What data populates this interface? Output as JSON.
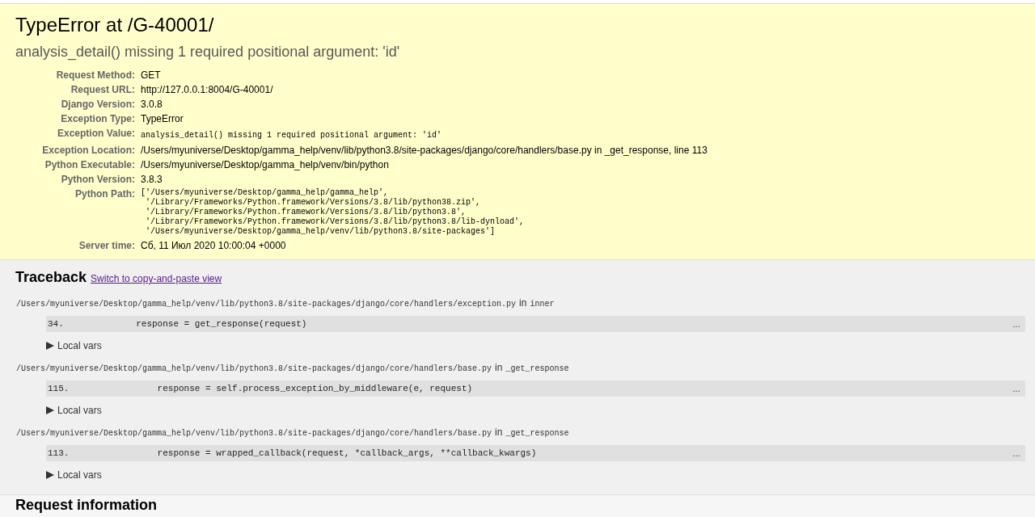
{
  "summary": {
    "title": "TypeError at /G-40001/",
    "subtitle": "analysis_detail() missing 1 required positional argument: 'id'",
    "meta": [
      {
        "label": "Request Method:",
        "kind": "text",
        "value": "GET"
      },
      {
        "label": "Request URL:",
        "kind": "text",
        "value": "http://127.0.0.1:8004/G-40001/"
      },
      {
        "label": "Django Version:",
        "kind": "text",
        "value": "3.0.8"
      },
      {
        "label": "Exception Type:",
        "kind": "text",
        "value": "TypeError"
      },
      {
        "label": "Exception Value:",
        "kind": "code",
        "value": "analysis_detail() missing 1 required positional argument: 'id'"
      },
      {
        "label": "Exception Location:",
        "kind": "text",
        "value": "/Users/myuniverse/Desktop/gamma_help/venv/lib/python3.8/site-packages/django/core/handlers/base.py in _get_response, line 113"
      },
      {
        "label": "Python Executable:",
        "kind": "text",
        "value": "/Users/myuniverse/Desktop/gamma_help/venv/bin/python"
      },
      {
        "label": "Python Version:",
        "kind": "text",
        "value": "3.8.3"
      },
      {
        "label": "Python Path:",
        "kind": "lines",
        "lines": [
          "['/Users/myuniverse/Desktop/gamma_help/gamma_help',",
          " '/Library/Frameworks/Python.framework/Versions/3.8/lib/python38.zip',",
          " '/Library/Frameworks/Python.framework/Versions/3.8/lib/python3.8',",
          " '/Library/Frameworks/Python.framework/Versions/3.8/lib/python3.8/lib-dynload',",
          " '/Users/myuniverse/Desktop/gamma_help/venv/lib/python3.8/site-packages']"
        ]
      },
      {
        "label": "Server time:",
        "kind": "text",
        "value": "Сб, 11 Июл 2020 10:00:04 +0000"
      }
    ]
  },
  "traceback": {
    "heading": "Traceback",
    "switch_link": "Switch to copy-and-paste view",
    "frames": [
      {
        "file": "/Users/myuniverse/Desktop/gamma_help/venv/lib/python3.8/site-packages/django/core/handlers/exception.py",
        "in_word": "in",
        "function": "inner",
        "line_number": "34.",
        "code": "            response = get_response(request)",
        "expand": "…",
        "local_vars": "Local vars",
        "expanded": false
      },
      {
        "file": "/Users/myuniverse/Desktop/gamma_help/venv/lib/python3.8/site-packages/django/core/handlers/base.py",
        "in_word": "in",
        "function": "_get_response",
        "line_number": "115.",
        "code": "                response = self.process_exception_by_middleware(e, request)",
        "expand": "…",
        "local_vars": "Local vars",
        "expanded": false
      },
      {
        "file": "/Users/myuniverse/Desktop/gamma_help/venv/lib/python3.8/site-packages/django/core/handlers/base.py",
        "in_word": "in",
        "function": "_get_response",
        "line_number": "113.",
        "code": "                response = wrapped_callback(request, *callback_args, **callback_kwargs)",
        "expand": "…",
        "local_vars": "Local vars",
        "expanded": false
      }
    ]
  },
  "request_info": {
    "heading": "Request information"
  }
}
